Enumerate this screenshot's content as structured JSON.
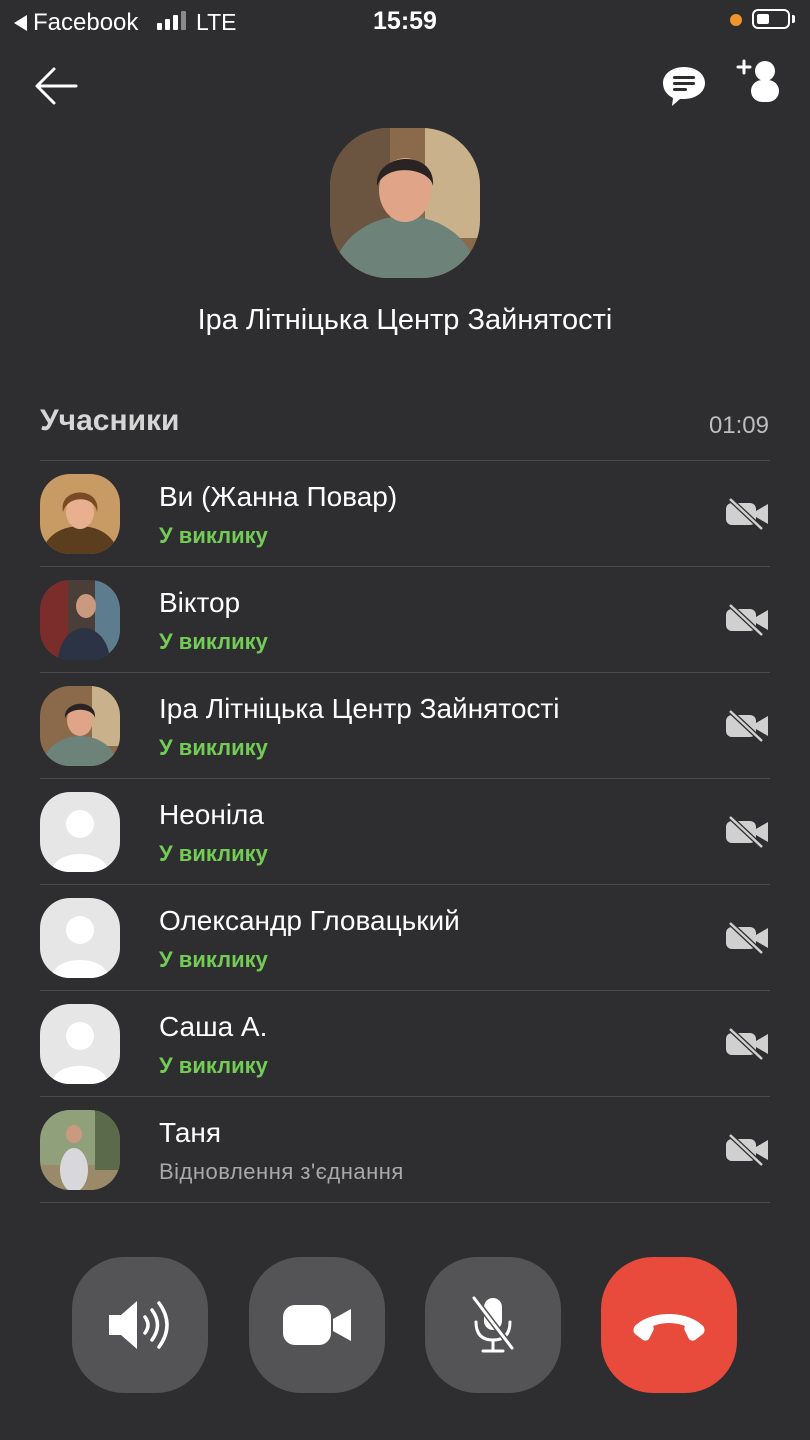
{
  "status_bar": {
    "back_app": "Facebook",
    "network": "LTE",
    "time": "15:59"
  },
  "header": {
    "back_icon": "arrow-left-icon",
    "chat_icon": "chat-bubble-icon",
    "add_icon": "add-participant-icon"
  },
  "call": {
    "title_name": "Іра Літніцька Центр Зайнятості",
    "section_label": "Учасники",
    "duration": "01:09"
  },
  "participants": [
    {
      "name": "Ви (Жанна Повар)",
      "status": "У виклику",
      "avatar": "photo"
    },
    {
      "name": "Віктор",
      "status": "У виклику",
      "avatar": "photo"
    },
    {
      "name": "Іра Літніцька Центр Зайнятості",
      "status": "У виклику",
      "avatar": "photo"
    },
    {
      "name": "Неоніла",
      "status": "У виклику",
      "avatar": "placeholder"
    },
    {
      "name": "Олександр Гловацький",
      "status": "У виклику",
      "avatar": "placeholder"
    },
    {
      "name": "Саша А.",
      "status": "У виклику",
      "avatar": "placeholder"
    },
    {
      "name": "Таня",
      "status": "Відновлення з'єднання",
      "avatar": "photo"
    }
  ],
  "controls": {
    "speaker_icon": "speaker-icon",
    "video_icon": "video-camera-icon",
    "mute_icon": "microphone-muted-icon",
    "end_icon": "end-call-icon"
  },
  "colors": {
    "background": "#2e2e30",
    "in_call_status": "#73cc55",
    "reconnecting_status": "#a9a9a9",
    "control_button": "#545456",
    "end_call": "#e84a3b",
    "battery_dot": "#f0952a"
  }
}
